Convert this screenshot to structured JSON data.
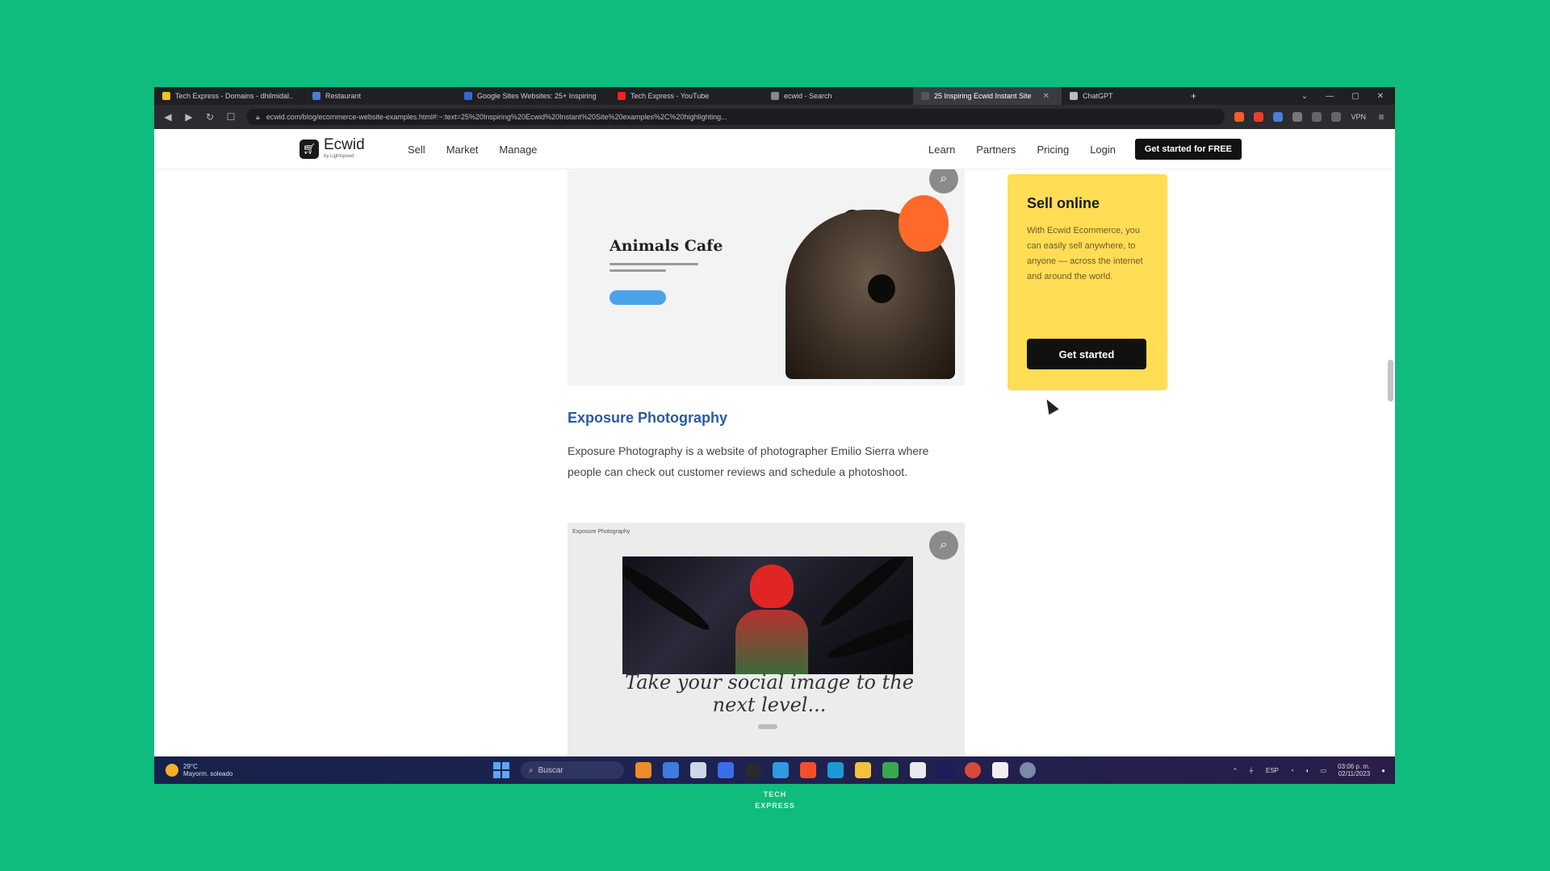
{
  "browser": {
    "tabs": [
      {
        "label": "Tech Express - Domains - dhilmidal..",
        "color": "#f6c026",
        "active": false
      },
      {
        "label": "Restaurant",
        "color": "#4c7bd9",
        "active": false
      },
      {
        "label": "Google Sites Websites: 25+ Inspiring",
        "color": "#2f6ad9",
        "active": false
      },
      {
        "label": "Tech Express - YouTube",
        "color": "#ff2020",
        "active": false
      },
      {
        "label": "ecwid - Search",
        "color": "#888888",
        "active": false
      },
      {
        "label": "25 Inspiring Ecwid Instant Site",
        "color": "#333333",
        "active": true
      },
      {
        "label": "ChatGPT",
        "color": "#bbbbbb",
        "active": false
      }
    ],
    "new_tab": "+",
    "url": "ecwid.com/blog/ecommerce-website-examples.html#:~:text=25%20Inspiring%20Ecwid%20Instant%20Site%20examples%2C%20highlighting...",
    "vpn_label": "VPN"
  },
  "site": {
    "logo_text": "Ecwid",
    "logo_sub": "by Lightspeed",
    "nav_left": [
      "Sell",
      "Market",
      "Manage"
    ],
    "nav_right": [
      "Learn",
      "Partners",
      "Pricing",
      "Login"
    ],
    "cta_label": "Get started for FREE"
  },
  "card1": {
    "title": "Animals Cafe"
  },
  "sidebar_card": {
    "title": "Sell online",
    "body": "With Ecwid Ecommerce, you can easily sell anywhere, to anyone — across the internet and around the world.",
    "button_label": "Get started"
  },
  "section": {
    "title": "Exposure Photography",
    "description": "Exposure Photography is a website of photographer Emilio Sierra where people can check out customer reviews and schedule a photoshoot."
  },
  "card2": {
    "caption": "Exposure Photography",
    "script_line1": "Take your social image to the",
    "script_line2": "next level..."
  },
  "taskbar": {
    "weather_temp": "29°C",
    "weather_desc": "Mayorm. soleado",
    "search_label": "Buscar",
    "language": "ESP",
    "time": "03:06 p. m.",
    "date": "02/11/2023"
  },
  "watermark": {
    "line1": "TECH",
    "line2": "EXPRESS"
  }
}
